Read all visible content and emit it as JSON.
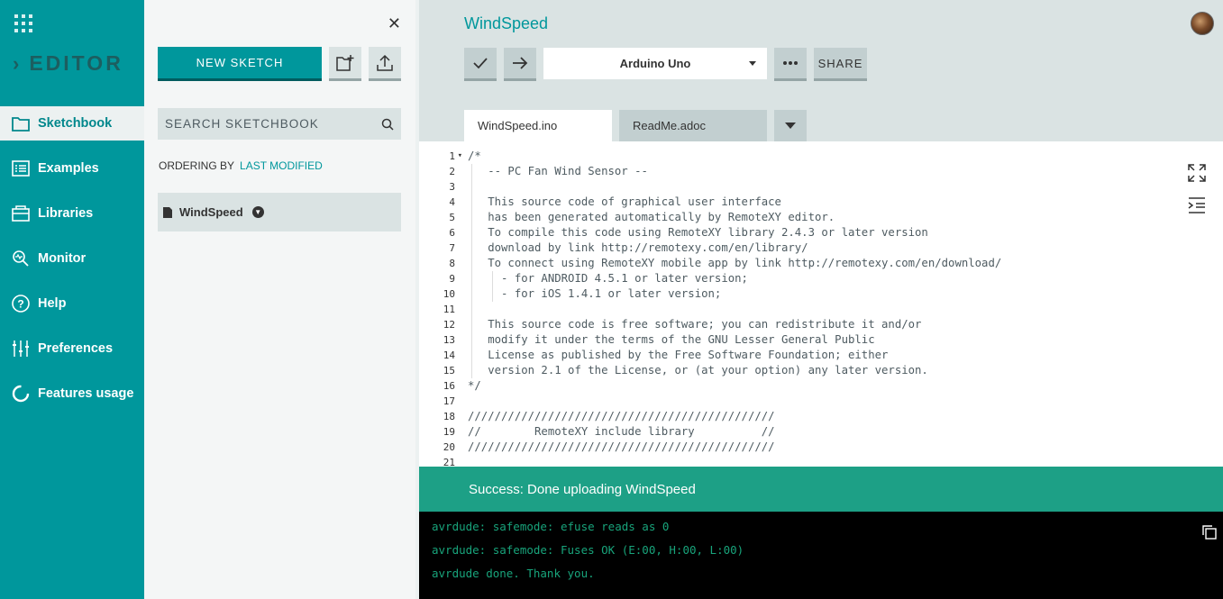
{
  "nav": {
    "brand": "EDITOR",
    "items": [
      {
        "label": "Sketchbook",
        "icon": "folder-icon",
        "active": true
      },
      {
        "label": "Examples",
        "icon": "list-icon"
      },
      {
        "label": "Libraries",
        "icon": "library-icon"
      },
      {
        "label": "Monitor",
        "icon": "monitor-icon"
      },
      {
        "label": "Help",
        "icon": "help-icon"
      },
      {
        "label": "Preferences",
        "icon": "sliders-icon"
      },
      {
        "label": "Features usage",
        "icon": "usage-icon"
      }
    ]
  },
  "panel": {
    "new_sketch_label": "NEW SKETCH",
    "search_placeholder": "SEARCH SKETCHBOOK",
    "ordering_label": "ORDERING BY",
    "ordering_value": "LAST MODIFIED",
    "sketches": [
      {
        "name": "WindSpeed"
      }
    ]
  },
  "editor": {
    "sketch_title": "WindSpeed",
    "board": "Arduino Uno",
    "share_label": "SHARE",
    "tabs": [
      {
        "label": "WindSpeed.ino",
        "active": true
      },
      {
        "label": "ReadMe.adoc"
      }
    ],
    "line_numbers": [
      "1",
      "2",
      "3",
      "4",
      "5",
      "6",
      "7",
      "8",
      "9",
      "10",
      "11",
      "12",
      "13",
      "14",
      "15",
      "16",
      "17",
      "18",
      "19",
      "20",
      "21"
    ],
    "code_lines": [
      "/*",
      "   -- PC Fan Wind Sensor --",
      "",
      "   This source code of graphical user interface",
      "   has been generated automatically by RemoteXY editor.",
      "   To compile this code using RemoteXY library 2.4.3 or later version",
      "   download by link http://remotexy.com/en/library/",
      "   To connect using RemoteXY mobile app by link http://remotexy.com/en/download/",
      "     - for ANDROID 4.5.1 or later version;",
      "     - for iOS 1.4.1 or later version;",
      "",
      "   This source code is free software; you can redistribute it and/or",
      "   modify it under the terms of the GNU Lesser General Public",
      "   License as published by the Free Software Foundation; either",
      "   version 2.1 of the License, or (at your option) any later version.",
      "*/",
      "",
      "//////////////////////////////////////////////",
      "//        RemoteXY include library          //",
      "//////////////////////////////////////////////",
      ""
    ]
  },
  "status": {
    "message": "Success: Done uploading WindSpeed"
  },
  "console": {
    "lines": [
      "avrdude: safemode: efuse reads as 0",
      "avrdude: safemode: Fuses OK (E:00, H:00, L:00)",
      "avrdude done. Thank you."
    ]
  },
  "colors": {
    "accent": "#00979c",
    "success": "#1da086",
    "console_text": "#18a47b"
  }
}
